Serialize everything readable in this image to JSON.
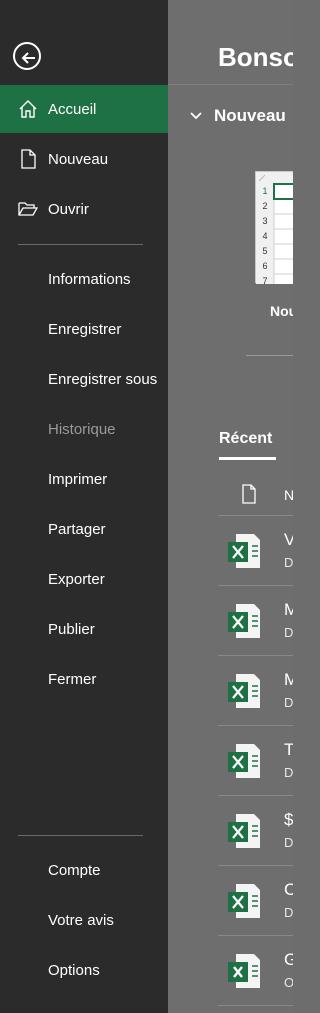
{
  "sidebar": {
    "items": [
      {
        "label": "Accueil",
        "icon": "home-icon",
        "active": true
      },
      {
        "label": "Nouveau",
        "icon": "new-document-icon"
      },
      {
        "label": "Ouvrir",
        "icon": "open-folder-icon"
      },
      {
        "label": "Informations"
      },
      {
        "label": "Enregistrer"
      },
      {
        "label": "Enregistrer sous"
      },
      {
        "label": "Historique",
        "disabled": true
      },
      {
        "label": "Imprimer"
      },
      {
        "label": "Partager"
      },
      {
        "label": "Exporter"
      },
      {
        "label": "Publier"
      },
      {
        "label": "Fermer"
      },
      {
        "label": "Compte"
      },
      {
        "label": "Votre avis"
      },
      {
        "label": "Options"
      }
    ],
    "accent_color": "#1e7145"
  },
  "main": {
    "greeting": "Bonso",
    "new_section_title": "Nouveau",
    "template_label": "Nou",
    "template_row_numbers": [
      "1",
      "2",
      "3",
      "4",
      "5",
      "6",
      "7"
    ],
    "recent_tab": "Récent",
    "name_column_header": "N",
    "files": [
      {
        "title": "V",
        "subtitle": "D"
      },
      {
        "title": "M",
        "subtitle": "D"
      },
      {
        "title": "M",
        "subtitle": "D"
      },
      {
        "title": "T",
        "subtitle": "D"
      },
      {
        "title": "$",
        "subtitle": "D"
      },
      {
        "title": "C",
        "subtitle": "D"
      },
      {
        "title": "G",
        "subtitle": "O"
      }
    ]
  }
}
